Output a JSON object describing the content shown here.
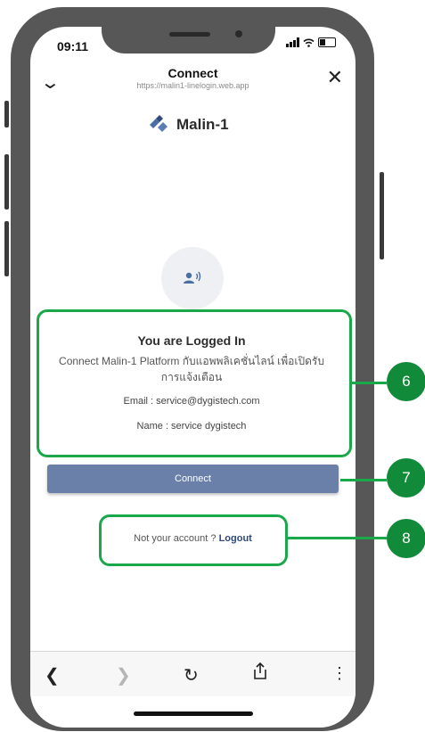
{
  "status_bar": {
    "time": "09:11"
  },
  "header": {
    "title": "Connect",
    "url": "https://malin1-linelogin.web.app"
  },
  "logo": {
    "text": "Malin-1"
  },
  "card": {
    "title": "You are Logged In",
    "description": "Connect Malin-1 Platform กับแอพพลิเคชั่นไลน์ เพื่อเปิดรับการแจ้งเตือน",
    "email": "Email : service@dygistech.com",
    "name": "Name : service dygistech"
  },
  "connect_button": {
    "label": "Connect"
  },
  "account": {
    "prompt": "Not your account ? ",
    "logout": "Logout"
  },
  "annotations": [
    "6",
    "7",
    "8"
  ],
  "colors": {
    "accent_green": "#1aa84a",
    "badge_green": "#118a3a",
    "button_blue": "#6b80a8",
    "logo_blue": "#4a6fa5"
  }
}
